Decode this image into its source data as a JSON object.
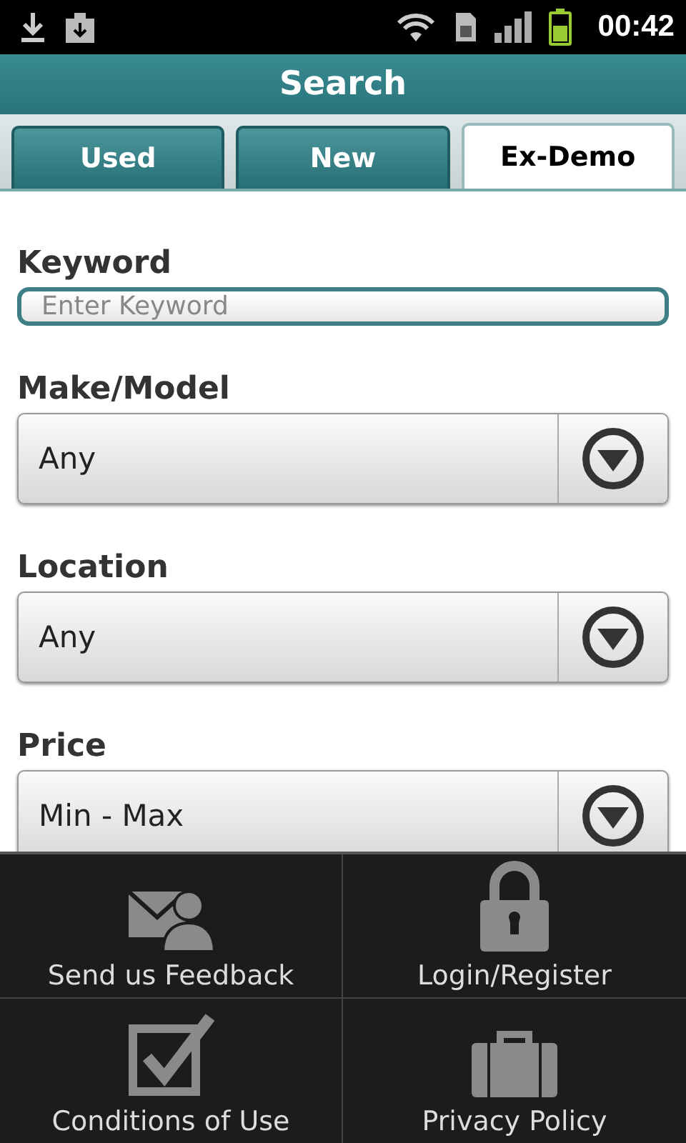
{
  "status_bar": {
    "time": "00:42"
  },
  "title": "Search",
  "tabs": [
    {
      "label": "Used",
      "selected": false
    },
    {
      "label": "New",
      "selected": false
    },
    {
      "label": "Ex-Demo",
      "selected": true
    }
  ],
  "fields": [
    {
      "kind": "text",
      "label": "Keyword",
      "placeholder": "Enter Keyword"
    },
    {
      "kind": "select",
      "label": "Make/Model",
      "value": "Any"
    },
    {
      "kind": "select",
      "label": "Location",
      "value": "Any"
    },
    {
      "kind": "select",
      "label": "Price",
      "value": "Min - Max"
    }
  ],
  "menu": [
    {
      "kind": "feedback",
      "label": "Send us Feedback"
    },
    {
      "kind": "lock",
      "label": "Login/Register"
    },
    {
      "kind": "checkbox",
      "label": "Conditions of Use"
    },
    {
      "kind": "briefcase",
      "label": "Privacy Policy"
    }
  ]
}
